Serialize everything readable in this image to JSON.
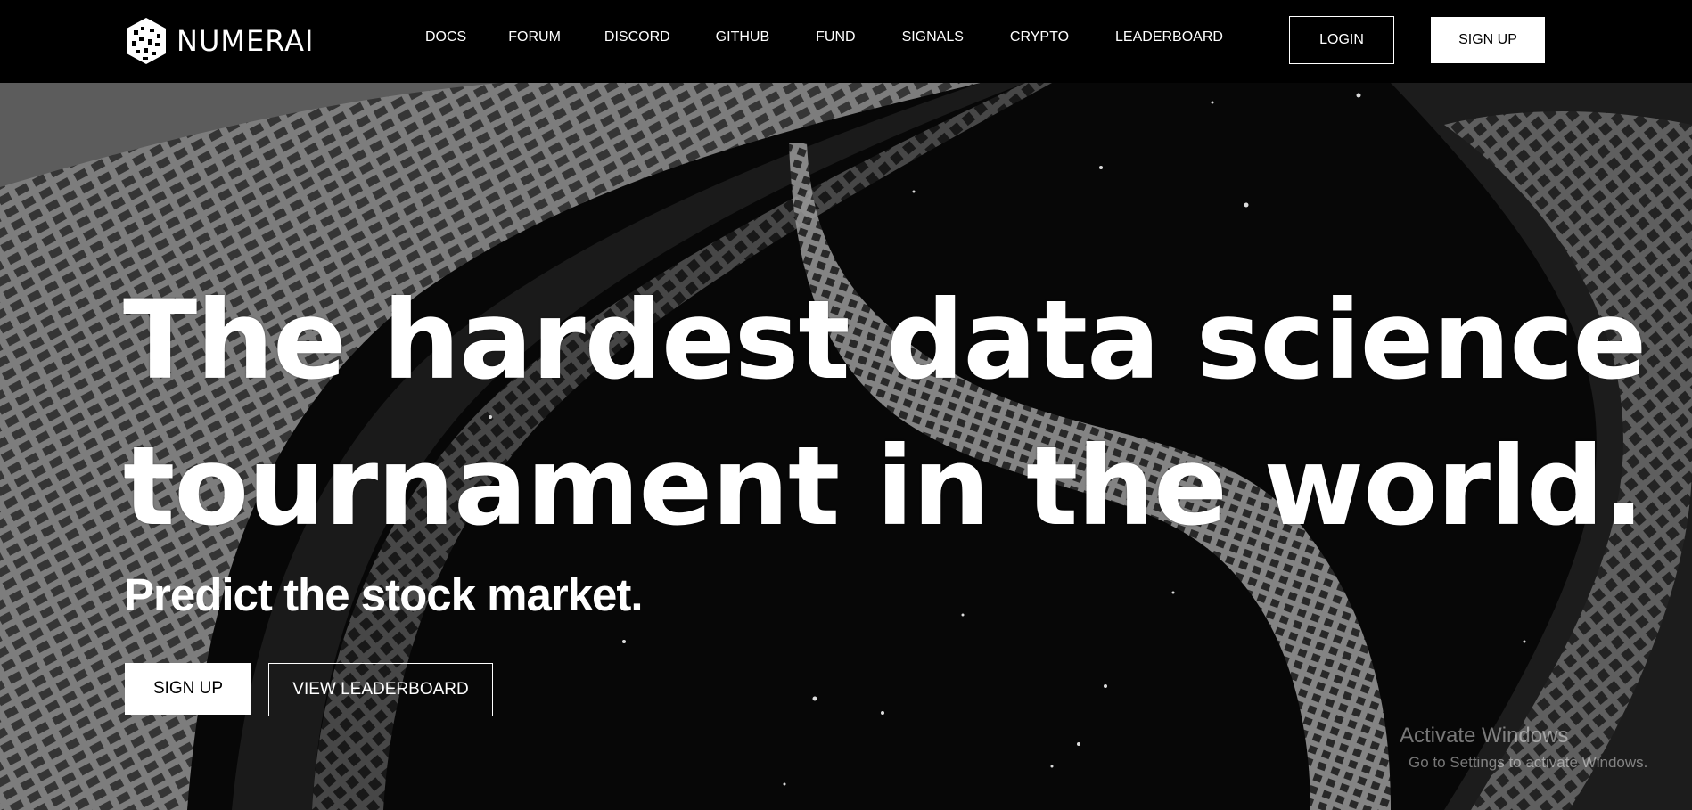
{
  "brand": {
    "name": "NUMERAI"
  },
  "nav": {
    "links": [
      "DOCS",
      "FORUM",
      "DISCORD",
      "GITHUB",
      "FUND",
      "SIGNALS",
      "CRYPTO",
      "LEADERBOARD"
    ],
    "login_label": "LOGIN",
    "signup_label": "SIGN UP"
  },
  "hero": {
    "title_line1": "The hardest data science",
    "title_line2": "tournament in the world.",
    "subtitle": "Predict the stock market.",
    "signup_label": "SIGN UP",
    "leaderboard_label": "VIEW LEADERBOARD"
  },
  "watermark": {
    "title": "Activate Windows",
    "subtitle": "Go to Settings to activate Windows."
  },
  "colors": {
    "nav_background": "#000000",
    "text": "#ffffff",
    "page_background": "#050505"
  },
  "icons": {
    "logo": "numerai-cube-logo-icon"
  }
}
